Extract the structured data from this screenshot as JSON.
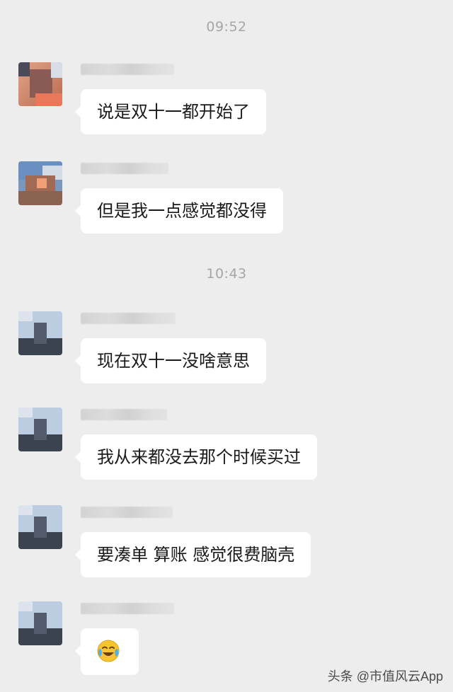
{
  "timestamps": [
    "09:52",
    "10:43"
  ],
  "messages": [
    {
      "text": "说是双十一都开始了"
    },
    {
      "text": "但是我一点感觉都没得"
    },
    {
      "text": "现在双十一没啥意思"
    },
    {
      "text": "我从来都没去那个时候买过"
    },
    {
      "text": "要凑单 算账 感觉很费脑壳"
    },
    {
      "emoji": "crying-laughing-emoji"
    }
  ],
  "watermark": "头条 @市值风云App",
  "colors": {
    "background": "#ededed",
    "bubble": "#ffffff",
    "timestamp": "#a6a6a6",
    "text": "#1a1a1a"
  }
}
